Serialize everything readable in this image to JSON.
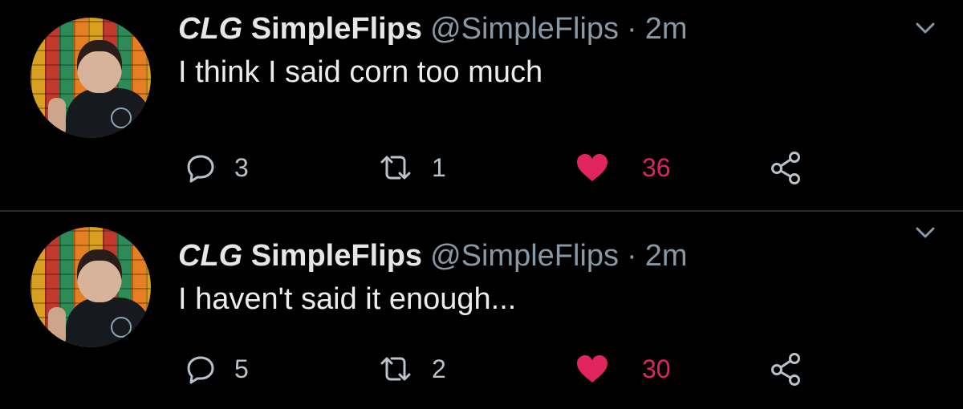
{
  "colors": {
    "background": "#000000",
    "text": "#e6e6e6",
    "secondary": "#8899a6",
    "like": "#e0245e",
    "divider": "#2a2d30"
  },
  "tweets": [
    {
      "display_name_prefix": "CLG",
      "display_name": "SimpleFlips",
      "handle": "@SimpleFlips",
      "separator": "·",
      "time": "2m",
      "text": "I think I said corn too much",
      "replies": "3",
      "retweets": "1",
      "likes": "36",
      "liked": true,
      "icons": [
        "reply-icon",
        "retweet-icon",
        "heart-icon",
        "share-icon",
        "chevron-down-icon"
      ]
    },
    {
      "display_name_prefix": "CLG",
      "display_name": "SimpleFlips",
      "handle": "@SimpleFlips",
      "separator": "·",
      "time": "2m",
      "text": "I haven't said it enough...",
      "replies": "5",
      "retweets": "2",
      "likes": "30",
      "liked": true,
      "icons": [
        "reply-icon",
        "retweet-icon",
        "heart-icon",
        "share-icon",
        "chevron-down-icon"
      ]
    }
  ]
}
